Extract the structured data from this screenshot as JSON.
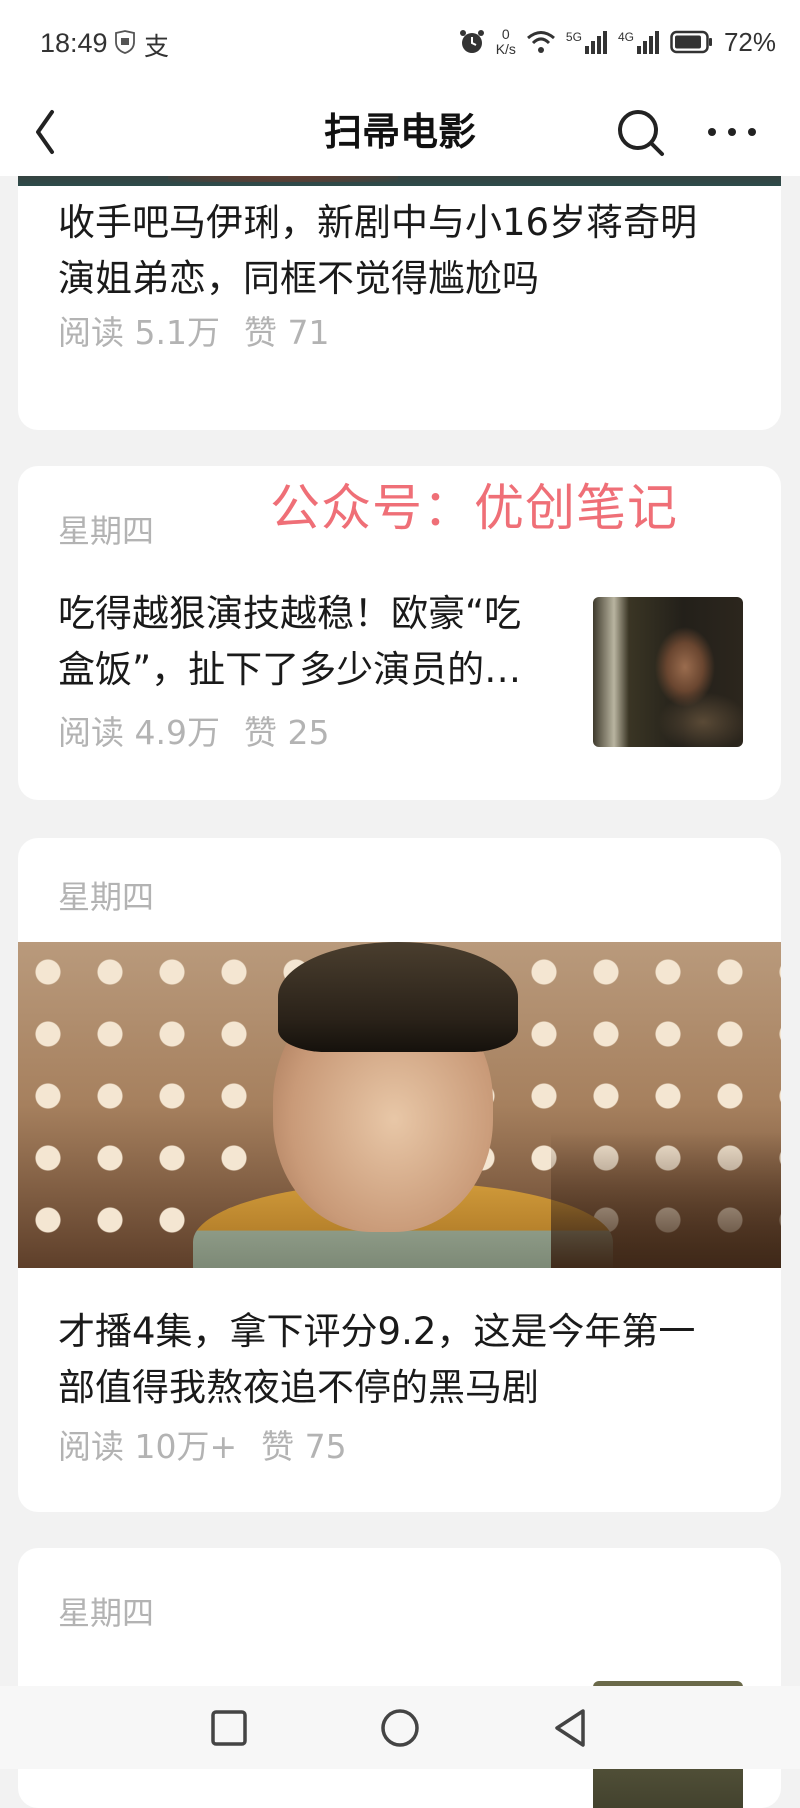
{
  "status_bar": {
    "time": "18:49",
    "pay_glyph": "支",
    "speed_value": "0",
    "speed_unit": "K/s",
    "net_5g": "5G",
    "net_4g": "4G",
    "battery_pct": "72%",
    "icons": [
      "shield-icon",
      "alarm-icon",
      "wifi-icon",
      "signal-icon",
      "battery-icon"
    ]
  },
  "nav": {
    "title": "扫帚电影",
    "icons": [
      "back-icon",
      "search-icon",
      "more-icon"
    ]
  },
  "watermark": "公众号：优创笔记",
  "articles": [
    {
      "title_line1": "收手吧马伊琍，新剧中与小16岁蒋奇明",
      "title_line2": "演姐弟恋，同框不觉得尴尬吗",
      "reads": "阅读 5.1万",
      "likes": "赞 71"
    },
    {
      "day": "星期四",
      "title_line1": "吃得越狠演技越稳！欧豪“吃",
      "title_line2": "盒饭”，扯下了多少演员的…",
      "reads": "阅读 4.9万",
      "likes": "赞 25"
    },
    {
      "day": "星期四",
      "title_line1": "才播4集，拿下评分9.2，这是今年第一",
      "title_line2": "部值得我熬夜追不停的黑马剧",
      "reads": "阅读 10万+",
      "likes": "赞 75"
    },
    {
      "day": "星期四"
    }
  ],
  "colors": {
    "background": "#f2f2f2",
    "card": "#ffffff",
    "meta_text": "#b3b3b3",
    "watermark": "#ef6f77"
  }
}
